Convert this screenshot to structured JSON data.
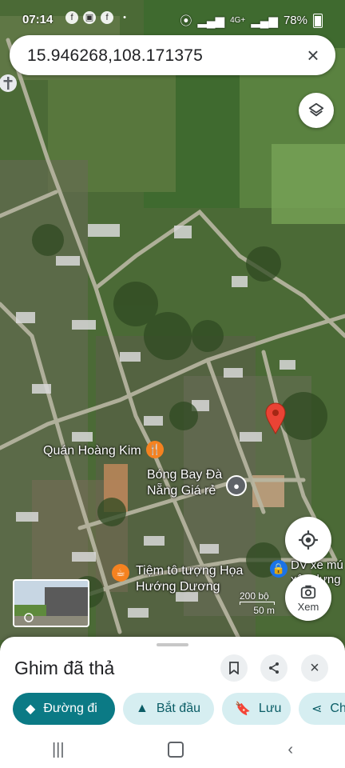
{
  "status_bar": {
    "time": "07:14",
    "battery": "78%",
    "network": "4G+",
    "left_icons": [
      "f",
      "▣",
      "f",
      "•"
    ]
  },
  "search": {
    "query": "15.946268,108.171375"
  },
  "map": {
    "places": [
      {
        "name": "Quán Hoàng Kim",
        "icon": "restaurant-icon"
      },
      {
        "name": "Bóng Bay Đà\nNẵng Giá rẻ",
        "icon": "place-icon"
      },
      {
        "name": "Tiệm tô tượng Họa\nHướng Dương",
        "icon": "cafe-icon"
      },
      {
        "name": "DV xe mú\nxây dựng",
        "icon": "shop-icon"
      }
    ],
    "scale": {
      "upper": "200 bộ",
      "lower": "50 m"
    }
  },
  "controls": {
    "lens_label": "Xem"
  },
  "sheet": {
    "title": "Ghim đã thả",
    "actions": [
      {
        "label": "Đường đi",
        "icon": "directions-icon"
      },
      {
        "label": "Bắt đầu",
        "icon": "navigation-icon"
      },
      {
        "label": "Lưu",
        "icon": "bookmark-icon"
      },
      {
        "label": "Chia sẻ",
        "icon": "share-icon"
      }
    ]
  },
  "colors": {
    "accent": "#0b7a85",
    "pin": "#ea4335",
    "chip_secondary": "#d6eef1"
  }
}
